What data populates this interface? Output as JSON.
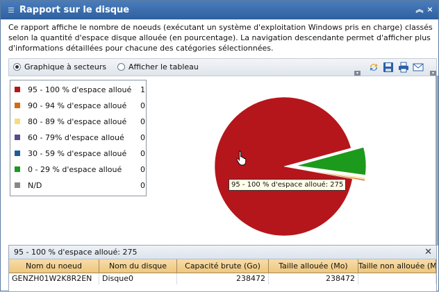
{
  "window": {
    "title": "Rapport sur le disque",
    "collapse_glyph": "≈",
    "close_glyph": "×"
  },
  "description": "Ce rapport affiche le nombre de noeuds (exécutant un système d'exploitation Windows pris en charge) classés selon la quantité d'espace disque allouée (en pourcentage). La navigation descendante permet d'afficher plus d'informations détaillées pour chacune des catégories sélectionnées.",
  "toolbar": {
    "radio_pie": "Graphique à secteurs",
    "radio_table": "Afficher le tableau",
    "selected": "pie",
    "icons": [
      "refresh-icon",
      "save-icon",
      "print-icon",
      "email-icon"
    ]
  },
  "legend": [
    {
      "label": "95 - 100 % d'espace alloué",
      "count": "1",
      "color": "#b5161b"
    },
    {
      "label": "90 - 94 % d'espace alloué",
      "count": "0",
      "color": "#d66a0f"
    },
    {
      "label": "80 - 89 % d'espace alloué",
      "count": "0",
      "color": "#f6dc7c"
    },
    {
      "label": "60 - 79% d'espace alloué",
      "count": "0",
      "color": "#5b4a8b"
    },
    {
      "label": "30 - 59 % d'espace alloué",
      "count": "0",
      "color": "#1d5c9c"
    },
    {
      "label": "0 - 29 % d'espace alloué",
      "count": "0",
      "color": "#1c9a1c"
    },
    {
      "label": "N/D",
      "count": "0",
      "color": "#888888"
    }
  ],
  "chart_data": {
    "type": "pie",
    "slices": [
      {
        "name": "95 - 100 % d'espace alloué",
        "value": 275,
        "color": "#b5161b"
      },
      {
        "name": "90 - 94 % d'espace alloué",
        "value": 1,
        "color": "#d66a0f"
      },
      {
        "name": "80 - 89 % d'espace alloué",
        "value": 1,
        "color": "#f6dc7c"
      },
      {
        "name": "0 - 29 % d'espace alloué",
        "value": 19,
        "color": "#1c9a1c"
      }
    ],
    "exploded": [
      "0 - 29 % d'espace alloué",
      "90 - 94 % d'espace alloué",
      "80 - 89 % d'espace alloué"
    ]
  },
  "tooltip": "95 - 100 % d'espace alloué: 275",
  "details": {
    "header": "95 - 100 % d'espace alloué:  275",
    "close_glyph": "✕",
    "columns": [
      "Nom du noeud",
      "Nom du disque",
      "Capacité brute (Go)",
      "Taille allouée (Mo)",
      "Taille non allouée (Mo)"
    ],
    "rows": [
      {
        "node": "GENZH01W2K8R2EN",
        "disk": "Disque0",
        "raw": "238472",
        "alloc": "238472",
        "unalloc": ""
      }
    ]
  }
}
